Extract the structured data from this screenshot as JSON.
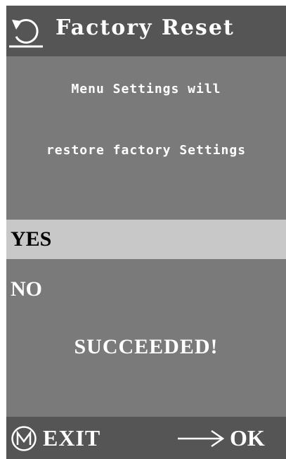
{
  "header": {
    "title": "Factory Reset",
    "back_icon": "undo-arrow-icon"
  },
  "message": {
    "line1": "Menu Settings will",
    "line2": "restore factory Settings"
  },
  "options": [
    {
      "label": "YES",
      "selected": true
    },
    {
      "label": "NO",
      "selected": false
    }
  ],
  "status": "SUCCEEDED!",
  "footer": {
    "exit_icon": "circled-m-icon",
    "exit_label": "EXIT",
    "ok_icon": "right-arrow-icon",
    "ok_label": "OK"
  },
  "colors": {
    "screen_background": "#7a7a7a",
    "bar_background": "#555555",
    "selection_highlight": "#c8c8c8",
    "text": "#ffffff"
  }
}
